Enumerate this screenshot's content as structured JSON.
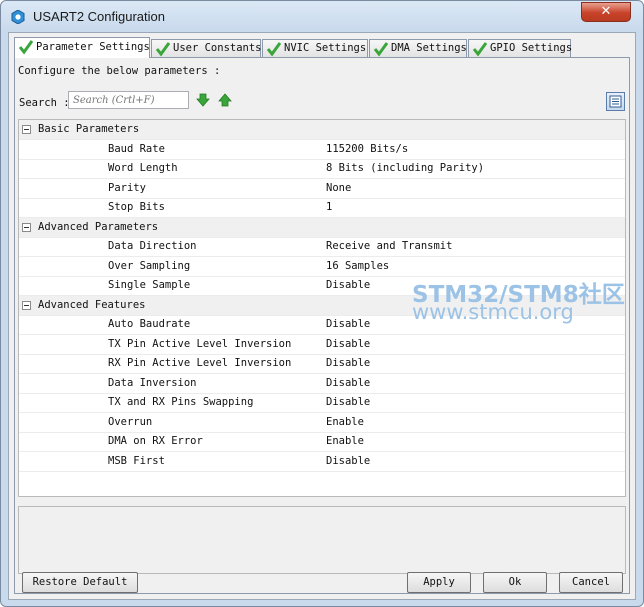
{
  "window": {
    "title": "USART2 Configuration",
    "close_glyph": "✕"
  },
  "tabs": [
    {
      "label": "Parameter Settings",
      "active": true
    },
    {
      "label": "User Constants",
      "active": false
    },
    {
      "label": "NVIC Settings",
      "active": false
    },
    {
      "label": "DMA Settings",
      "active": false
    },
    {
      "label": "GPIO Settings",
      "active": false
    }
  ],
  "description": "Configure the below parameters :",
  "search": {
    "label": "Search :",
    "placeholder": "Search (Crtl+F)"
  },
  "groups": [
    {
      "name": "Basic Parameters",
      "params": [
        {
          "name": "Baud Rate",
          "value": "115200 Bits/s"
        },
        {
          "name": "Word Length",
          "value": "8 Bits (including Parity)"
        },
        {
          "name": "Parity",
          "value": "None"
        },
        {
          "name": "Stop Bits",
          "value": "1"
        }
      ]
    },
    {
      "name": "Advanced Parameters",
      "params": [
        {
          "name": "Data Direction",
          "value": "Receive and Transmit"
        },
        {
          "name": "Over Sampling",
          "value": "16 Samples"
        },
        {
          "name": "Single Sample",
          "value": "Disable"
        }
      ]
    },
    {
      "name": "Advanced Features",
      "params": [
        {
          "name": "Auto Baudrate",
          "value": "Disable"
        },
        {
          "name": "TX Pin Active Level Inversion",
          "value": "Disable"
        },
        {
          "name": "RX Pin Active Level Inversion",
          "value": "Disable"
        },
        {
          "name": "Data Inversion",
          "value": "Disable"
        },
        {
          "name": "TX and RX Pins Swapping",
          "value": "Disable"
        },
        {
          "name": "Overrun",
          "value": "Enable"
        },
        {
          "name": "DMA on RX Error",
          "value": "Enable"
        },
        {
          "name": "MSB First",
          "value": "Disable"
        }
      ]
    }
  ],
  "buttons": {
    "restore_default": "Restore Default",
    "apply": "Apply",
    "ok": "Ok",
    "cancel": "Cancel"
  },
  "watermark": {
    "line1": "STM32/STM8社区",
    "line2": "www.stmcu.org"
  },
  "icons": {
    "app": "usart-config-icon",
    "tab_check": "green-check-icon",
    "search_next": "green-down-arrow-icon",
    "search_prev": "green-up-arrow-icon",
    "view_toggle": "list-view-icon",
    "group_toggle": "collapse-minus-icon"
  },
  "colors": {
    "check_green": "#3aa53a",
    "title_bg": "#c9daed",
    "close_red": "#c8432a",
    "watermark": "#9cc3e6"
  }
}
